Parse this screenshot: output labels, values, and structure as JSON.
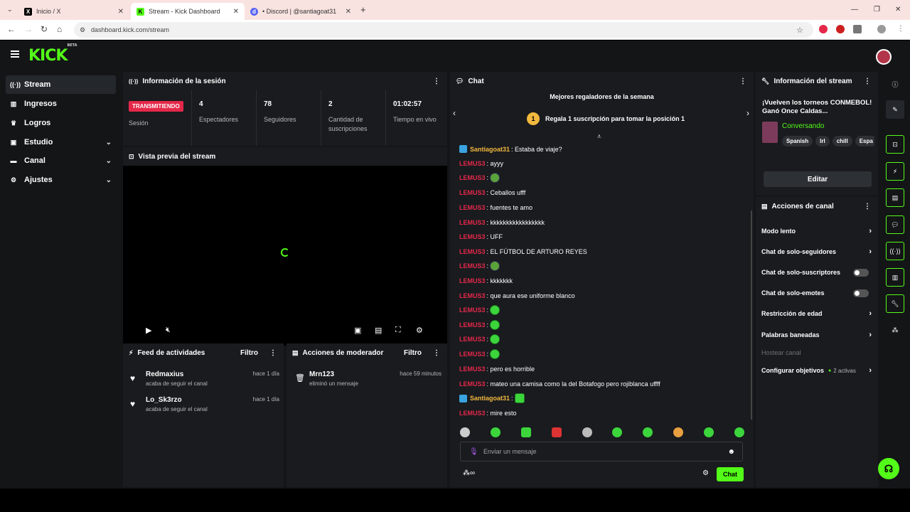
{
  "browser": {
    "tabs": [
      {
        "title": "Inicio / X",
        "icon": "x-icon"
      },
      {
        "title": "Stream - Kick Dashboard",
        "icon": "kick-icon"
      },
      {
        "title": "• Discord | @santiagoat31",
        "icon": "discord-icon"
      }
    ],
    "url": "dashboard.kick.com/stream"
  },
  "app": {
    "logo": "KICK",
    "logo_tag": "BETA"
  },
  "sidebar": {
    "items": [
      {
        "label": "Stream",
        "icon": "stream-icon"
      },
      {
        "label": "Ingresos",
        "icon": "revenue-icon"
      },
      {
        "label": "Logros",
        "icon": "trophy-icon"
      },
      {
        "label": "Estudio",
        "icon": "studio-icon"
      },
      {
        "label": "Canal",
        "icon": "channel-icon"
      },
      {
        "label": "Ajustes",
        "icon": "gear-icon"
      }
    ]
  },
  "session": {
    "title": "Información de la sesión",
    "status": "TRANSMITIENDO",
    "status_label": "Sesión",
    "stats": [
      {
        "value": "4",
        "label": "Espectadores"
      },
      {
        "value": "78",
        "label": "Seguidores"
      },
      {
        "value": "2",
        "label": "Cantidad de suscripciones"
      },
      {
        "value": "01:02:57",
        "label": "Tiempo en vivo"
      }
    ]
  },
  "preview": {
    "title": "Vista previa del stream"
  },
  "activity": {
    "title": "Feed de actividades",
    "filter": "Filtro",
    "items": [
      {
        "name": "Redmaxius",
        "desc": "acaba de seguir el canal",
        "time": "hace 1 día"
      },
      {
        "name": "Lo_Sk3rzo",
        "desc": "acaba de seguir el canal",
        "time": "hace 1 día"
      }
    ]
  },
  "moderator": {
    "title": "Acciones de moderador",
    "filter": "Filtro",
    "items": [
      {
        "name": "Mrn123",
        "desc": "eliminó un mensaje",
        "time": "hace 59 minutos"
      }
    ]
  },
  "chat": {
    "title": "Chat",
    "gifters_title": "Mejores regaladores de la semana",
    "gifters_rank": "1",
    "gifters_text": "Regala 1 suscripción para tomar la posición 1",
    "messages": [
      {
        "user": "Santiagoat31",
        "text": ": Estaba de viaje?",
        "verified": true
      },
      {
        "user": "LEMUS3",
        "text": ": ayyy"
      },
      {
        "user": "LEMUS3",
        "text": ":",
        "emote": true
      },
      {
        "user": "LEMUS3",
        "text": ": Ceballos ufff"
      },
      {
        "user": "LEMUS3",
        "text": ": fuentes te amo"
      },
      {
        "user": "LEMUS3",
        "text": ": kkkkkkkkkkkkkkkkk"
      },
      {
        "user": "LEMUS3",
        "text": ": UFF"
      },
      {
        "user": "LEMUS3",
        "text": ": EL FÚTBOL DE ARTURO REYES"
      },
      {
        "user": "LEMUS3",
        "text": ":",
        "emote": true
      },
      {
        "user": "LEMUS3",
        "text": ": kkkkkkk"
      },
      {
        "user": "LEMUS3",
        "text": ": que aura ese uniforme blanco"
      },
      {
        "user": "LEMUS3",
        "text": ":",
        "emote": true
      },
      {
        "user": "LEMUS3",
        "text": ":",
        "emote": true
      },
      {
        "user": "LEMUS3",
        "text": ":",
        "emote": true
      },
      {
        "user": "LEMUS3",
        "text": ":",
        "emote": true
      },
      {
        "user": "LEMUS3",
        "text": ": pero es horrible"
      },
      {
        "user": "LEMUS3",
        "text": ": mateo una camisa como la del Botafogo pero rojiblanca uffff"
      },
      {
        "user": "Santiagoat31",
        "text": ":",
        "emote": true,
        "verified": true
      },
      {
        "user": "LEMUS3",
        "text": ": mire esto"
      }
    ],
    "input_placeholder": "Enviar un mensaje",
    "send_label": "Chat"
  },
  "stream_info": {
    "title": "Información del stream",
    "stream_title": "¡Vuelven los torneos CONMEBOL! Ganó Once Caldas...",
    "category": "Conversando",
    "tags": [
      "Spanish",
      "lrl",
      "chill",
      "Espa"
    ],
    "edit_label": "Editar"
  },
  "channel_actions": {
    "title": "Acciones de canal",
    "items": [
      {
        "label": "Modo lento",
        "type": "chevron"
      },
      {
        "label": "Chat de solo-seguidores",
        "type": "chevron"
      },
      {
        "label": "Chat de solo-suscriptores",
        "type": "toggle"
      },
      {
        "label": "Chat de solo-emotes",
        "type": "toggle"
      },
      {
        "label": "Restricción de edad",
        "type": "chevron"
      },
      {
        "label": "Palabras baneadas",
        "type": "chevron"
      },
      {
        "label": "Hostear canal",
        "type": "disabled"
      },
      {
        "label": "Configurar objetivos",
        "type": "chevron",
        "extra": "2 activas"
      }
    ]
  },
  "colors": {
    "accent": "#53fc18",
    "live": "#e42849",
    "panel": "#191b1f",
    "bg": "#141517"
  }
}
